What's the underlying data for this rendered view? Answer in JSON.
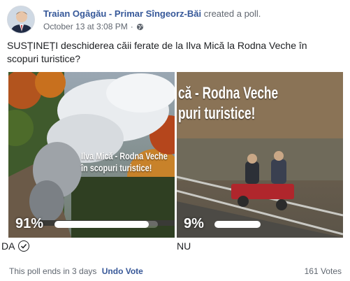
{
  "post": {
    "author": "Traian Ogâgău - Primar Sîngeorz-Băi",
    "action": "created a poll.",
    "timestamp": "October 13 at 3:08 PM",
    "separator": "·",
    "privacy_icon": "globe-icon"
  },
  "poll": {
    "question": "SUSȚINEȚI deschiderea căii ferate de la Ilva Mică la Rodna Veche în scopuri turistice?",
    "options": [
      {
        "label": "DA",
        "percent_text": "91%",
        "percent": 91,
        "selected": true,
        "image_caption_line1": "Ilva Mică - Rodna Veche",
        "image_caption_line2": "în scopuri turistice!"
      },
      {
        "label": "NU",
        "percent_text": "9%",
        "percent": 9,
        "selected": false,
        "image_caption_line1": "că - Rodna Veche",
        "image_caption_line2": "puri turistice!"
      }
    ],
    "ends_text": "This poll ends in 3 days",
    "undo_label": "Undo Vote",
    "votes_text": "161 Votes"
  },
  "colors": {
    "link": "#365899",
    "meta": "#616770",
    "text": "#1c1e21"
  }
}
